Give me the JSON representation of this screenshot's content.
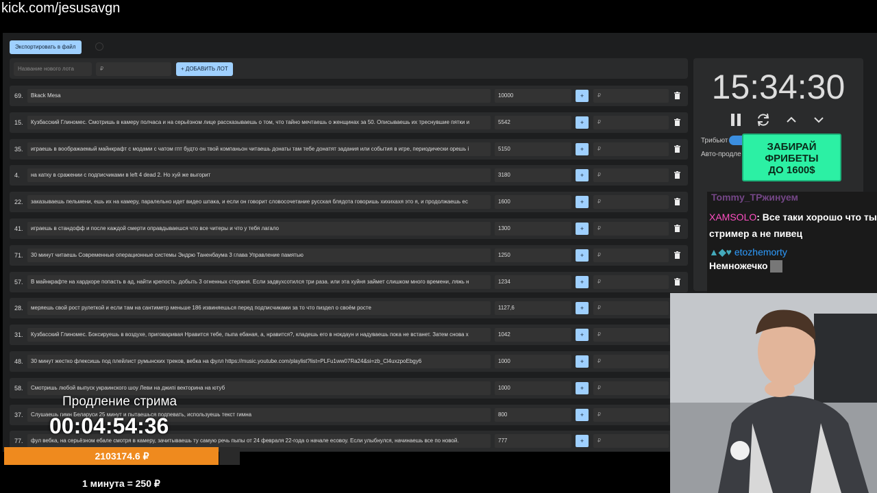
{
  "browser": {
    "url": "kick.com/jesusavgn"
  },
  "toolbar": {
    "export_label": "Экспортировать в файл"
  },
  "add_lot": {
    "name_placeholder": "Название нового лота",
    "price_placeholder": "₽",
    "add_label": "+ ДОБАВИТЬ ЛОТ"
  },
  "lots": [
    {
      "num": "69.",
      "name": "Bkack Mesa",
      "amount": "10000"
    },
    {
      "num": "15.",
      "name": "Кузбасский Глиномес. Смотришь в камеру полчаса и на серьёзном лице рассказываешь о том, что тайно мечтаешь о женщинах за 50. Описываешь их треснувшие пятки и",
      "amount": "5542"
    },
    {
      "num": "35.",
      "name": "играешь в воображаемый майнкрафт с модами с чатом гпт будто он твой компаньон читаешь донаты там тебе донатят задания или события в игре, периодически орешь i",
      "amount": "5150"
    },
    {
      "num": "4.",
      "name": "на катку в сражении с подписчиками в left 4 dead 2. Но хуй же выгорит",
      "amount": "3180"
    },
    {
      "num": "22.",
      "name": "заказываешь пельмени, ешь их на камеру, паралельно идет видео шпака, и если он говорит словосочетание русская блядота говоришь хихихахя это я, и продолжаешь ес",
      "amount": "1600"
    },
    {
      "num": "41.",
      "name": "играешь в стандофф и после каждой смерти оправдываешся что все читеры и что у тебя лагало",
      "amount": "1300"
    },
    {
      "num": "71.",
      "name": "30 минут читаешь Современные операционные системы Эндрю Таненбаума 3 глава Управление памятью",
      "amount": "1250"
    },
    {
      "num": "57.",
      "name": "В майнкрафте на хардкоре попасть в ад, найти крепость. добыть 3 огненных стержня. Если задвухсотился три раза. или эта хуйня займет слишком много времени, ляжь н",
      "amount": "1234"
    },
    {
      "num": "28.",
      "name": "меряешь свой рост рулеткой и если там на сантиметр меньше 186 извиняешься перед подписчиками за то что пиздел о своём росте",
      "amount": "1127,6"
    },
    {
      "num": "31.",
      "name": "Кузбасский Глиномес. Боксируешь в воздухе, приговаривая Нравится тебе, пыпа ебаная, а, нравится?, кладешь его в нокдаун и надуваешь пока не встанет. Затем снова х",
      "amount": "1042"
    },
    {
      "num": "48.",
      "name": "30 минут жестко флексишь под плейлист румынских треков, вебка на фулл https://music.youtube.com/playlist?list=PLFu1ww07Ra24&si=zb_Cl4uxzpoEbgy6",
      "amount": "1000"
    },
    {
      "num": "58.",
      "name": "Смотришь любой выпуск украинского шоу Леви на джипі вектоpина на ютуб",
      "amount": "1000"
    },
    {
      "num": "37.",
      "name": "Слушаешь гимн Беларуси 25 минут и пытаешься подпевать, используешь текст гимна",
      "amount": "800"
    },
    {
      "num": "77.",
      "name": "фул вебка, на серьёзном ебале смотря в камеру, зачитываешь ту самую речь пыпы от 24 февраля 22-года о начале есовоу. Если улыбнулся, начинаешь все по новой.",
      "amount": "777"
    }
  ],
  "lot_price_placeholder": "₽",
  "timer": {
    "time": "15:34:30",
    "tribute_label": "Трибьют",
    "auto_label": "Авто-продле"
  },
  "ad": {
    "line1": "ЗАБИРАЙ",
    "line2": "ФРИБЕТЫ",
    "line3": "ДО 1600$"
  },
  "chat": [
    {
      "user": "Tommy_T",
      "text": "Ржинуем",
      "color": "#9b59b6"
    },
    {
      "user": "XAMSOLO",
      "text": ": Все таки хорошо что ты стример а не пивец",
      "color": "#ff4fc3"
    },
    {
      "user": "etozhemorty",
      "text": ": Немножечко",
      "color": "#2d9cff"
    }
  ],
  "stream": {
    "extension_title": "Продление стрима",
    "extension_time": "00:04:54:36",
    "total": "2103174.6 ₽",
    "rate": "1 минута = 250 ₽",
    "progress_fraction": 0.91
  },
  "colors": {
    "accent": "#9fd0ff",
    "panel": "#2a2b2c",
    "orange": "#ef8a1e",
    "ad": "#2cf0a4"
  }
}
